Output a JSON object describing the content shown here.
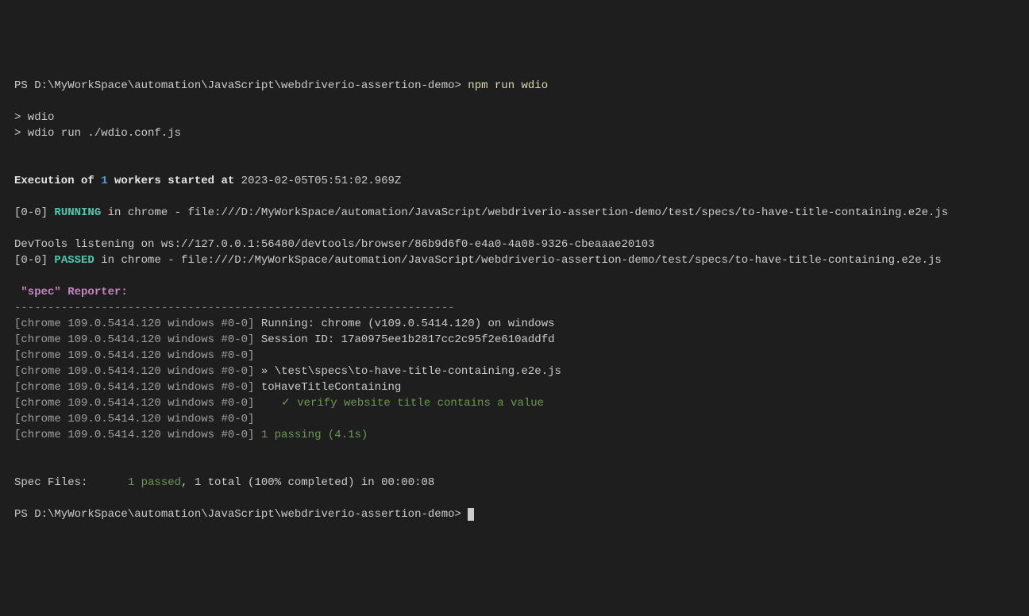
{
  "line1": {
    "prompt": "PS D:\\MyWorkSpace\\automation\\JavaScript\\webdriverio-assertion-demo> ",
    "command": "npm run wdio"
  },
  "line2": "> wdio",
  "line3": "> wdio run ./wdio.conf.js",
  "exec": {
    "prefix": "Execution of ",
    "count": "1",
    "mid": " workers started at",
    "timestamp": " 2023-02-05T05:51:02.969Z"
  },
  "running": {
    "prefix": "[0-0] ",
    "status": "RUNNING",
    "suffix": " in chrome - file:///D:/MyWorkSpace/automation/JavaScript/webdriverio-assertion-demo/test/specs/to-have-title-containing.e2e.js"
  },
  "devtools": "DevTools listening on ws://127.0.0.1:56480/devtools/browser/86b9d6f0-e4a0-4a08-9326-cbeaaae20103",
  "passed": {
    "prefix": "[0-0] ",
    "status": "PASSED",
    "suffix": " in chrome - file:///D:/MyWorkSpace/automation/JavaScript/webdriverio-assertion-demo/test/specs/to-have-title-containing.e2e.js"
  },
  "reporter": " \"spec\" Reporter:",
  "dashes": "------------------------------------------------------------------",
  "spec": {
    "prefix": "[chrome 109.0.5414.120 windows #0-0]",
    "l1": " Running: chrome (v109.0.5414.120) on windows",
    "l2": " Session ID: 17a0975ee1b2817cc2c95f2e610addfd",
    "l3": "",
    "l4": " » \\test\\specs\\to-have-title-containing.e2e.js",
    "l5": " toHaveTitleContaining",
    "l6pad": "    ",
    "l6check": "✓ ",
    "l6text": "verify website title contains a value",
    "l7": "",
    "l8": " 1 passing (4.1s)"
  },
  "summary": {
    "label": "Spec Files:      ",
    "passed": "1 passed",
    "rest": ", 1 total (100% completed) in 00:00:08"
  },
  "finalPrompt": "PS D:\\MyWorkSpace\\automation\\JavaScript\\webdriverio-assertion-demo> "
}
